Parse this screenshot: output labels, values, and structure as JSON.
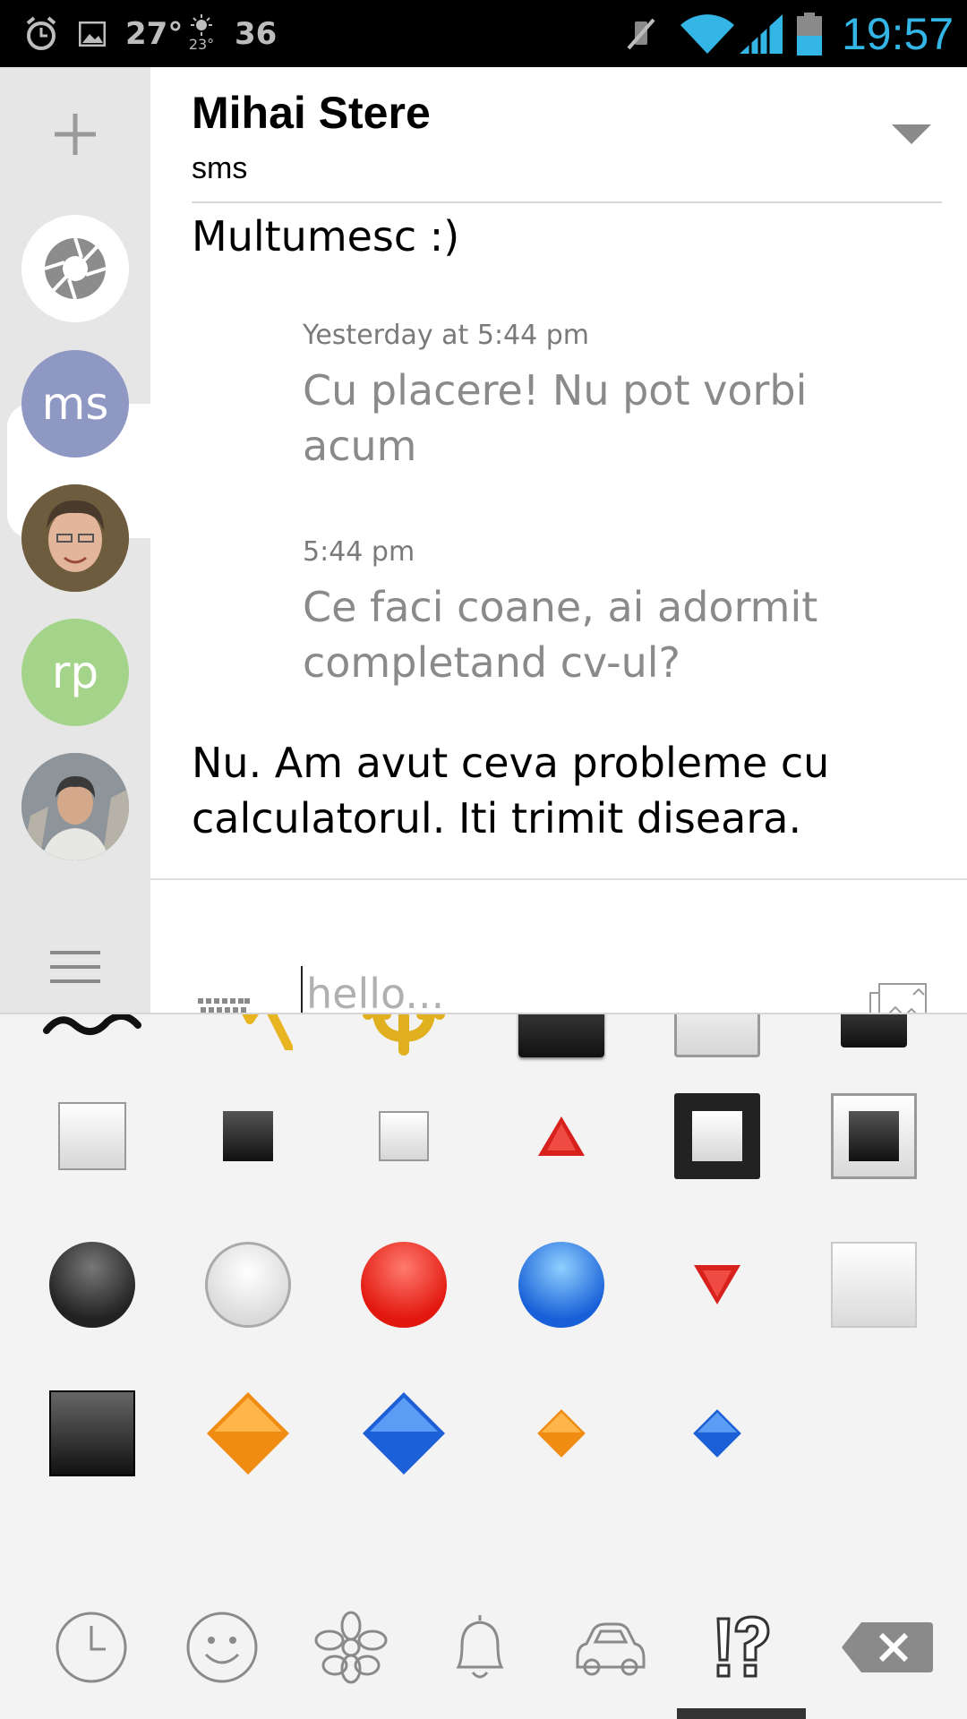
{
  "status_bar": {
    "temperature": "27°",
    "weather_small": "23°",
    "notification_count": "36",
    "time": "19:57"
  },
  "rail": {
    "add_label": "+",
    "contacts": [
      {
        "initials": "ms",
        "color": "#8f97c3",
        "active": true
      },
      {
        "initials": "",
        "color": "#b08b6a",
        "active": false
      },
      {
        "initials": "rp",
        "color": "#a3d489",
        "active": false
      },
      {
        "initials": "",
        "color": "#7d8791",
        "active": false
      }
    ]
  },
  "conversation": {
    "contact_name": "Mihai Stere",
    "channel": "sms",
    "messages": [
      {
        "direction": "out",
        "text": "Multumesc :)"
      },
      {
        "direction": "in",
        "time": "Yesterday at 5:44 pm",
        "text": " Cu placere! Nu pot vorbi acum"
      },
      {
        "direction": "in",
        "time": "5:44 pm",
        "text": "Ce faci coane, ai adormit completand cv-ul?"
      },
      {
        "direction": "out",
        "text": "Nu. Am avut ceva probleme cu calculatorul. Iti trimit diseara."
      }
    ],
    "input_placeholder": "hello..."
  },
  "emoji_panel": {
    "symbols": [
      "wavy-dash",
      "part-alternation-mark",
      "trident-emblem",
      "black-medium-square",
      "white-medium-square",
      "black-medium-square-small",
      "white-medium-small-square",
      "black-small-square",
      "white-small-square",
      "red-triangle-up",
      "black-square-button",
      "white-square-button",
      "black-circle",
      "white-circle",
      "red-circle",
      "blue-circle",
      "red-triangle-down",
      "white-large-square",
      "black-large-square",
      "large-orange-diamond",
      "large-blue-diamond",
      "small-orange-diamond",
      "small-blue-diamond"
    ],
    "tabs": [
      "recent-tab",
      "smileys-tab",
      "nature-tab",
      "objects-tab",
      "places-tab",
      "symbols-tab"
    ],
    "selected_tab": "symbols-tab"
  }
}
